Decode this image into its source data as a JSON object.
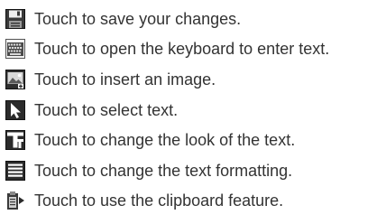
{
  "items": [
    {
      "icon": "save-icon",
      "label": "Touch to save your changes."
    },
    {
      "icon": "keyboard-icon",
      "label": "Touch to open the keyboard to enter text."
    },
    {
      "icon": "insert-image-icon",
      "label": "Touch to insert an image."
    },
    {
      "icon": "select-cursor-icon",
      "label": "Touch to select text."
    },
    {
      "icon": "text-style-icon",
      "label": "Touch to change the look of the text."
    },
    {
      "icon": "text-formatting-icon",
      "label": "Touch to change the text formatting."
    },
    {
      "icon": "clipboard-icon",
      "label": "Touch to use the clipboard feature."
    }
  ],
  "colors": {
    "text": "#333333",
    "icon_dark": "#2b2b2b",
    "icon_mid": "#6a6a6a",
    "icon_light": "#c8c8c8"
  }
}
